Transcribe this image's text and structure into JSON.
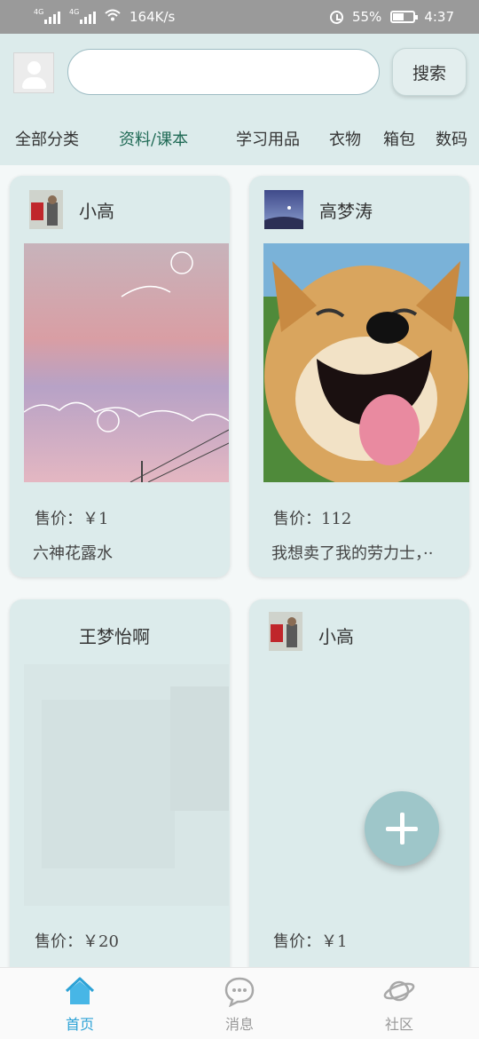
{
  "status_bar": {
    "net_label_1": "4G",
    "net_label_2": "4G",
    "speed": "164K/s",
    "battery": "55%",
    "time": "4:37"
  },
  "header": {
    "search_placeholder": "",
    "search_button": "搜索",
    "categories": [
      "全部分类",
      "资料/课本",
      "学习用品",
      "衣物",
      "箱包",
      "数码"
    ],
    "active_category": "资料/课本"
  },
  "cards": [
    {
      "seller": "小高",
      "price": "售价：￥1",
      "description": "六神花露水"
    },
    {
      "seller": "高梦涛",
      "price": "售价：112",
      "description": "我想卖了我的劳力士，··"
    },
    {
      "seller": "王梦怡啊",
      "price": "售价：￥20",
      "description": ""
    },
    {
      "seller": "小高",
      "price": "售价：￥1",
      "description": ""
    }
  ],
  "fab": {
    "icon": "plus-icon"
  },
  "bottom_nav": [
    {
      "label": "首页",
      "icon": "home-icon",
      "active": true
    },
    {
      "label": "消息",
      "icon": "chat-icon",
      "active": false
    },
    {
      "label": "社区",
      "icon": "planet-icon",
      "active": false
    }
  ],
  "colors": {
    "header_bg": "#dcebeb",
    "card_bg": "#dcebeb",
    "active_tab": "#1f6a55",
    "nav_active": "#2ca2d6",
    "fab": "#9ec6c9"
  }
}
